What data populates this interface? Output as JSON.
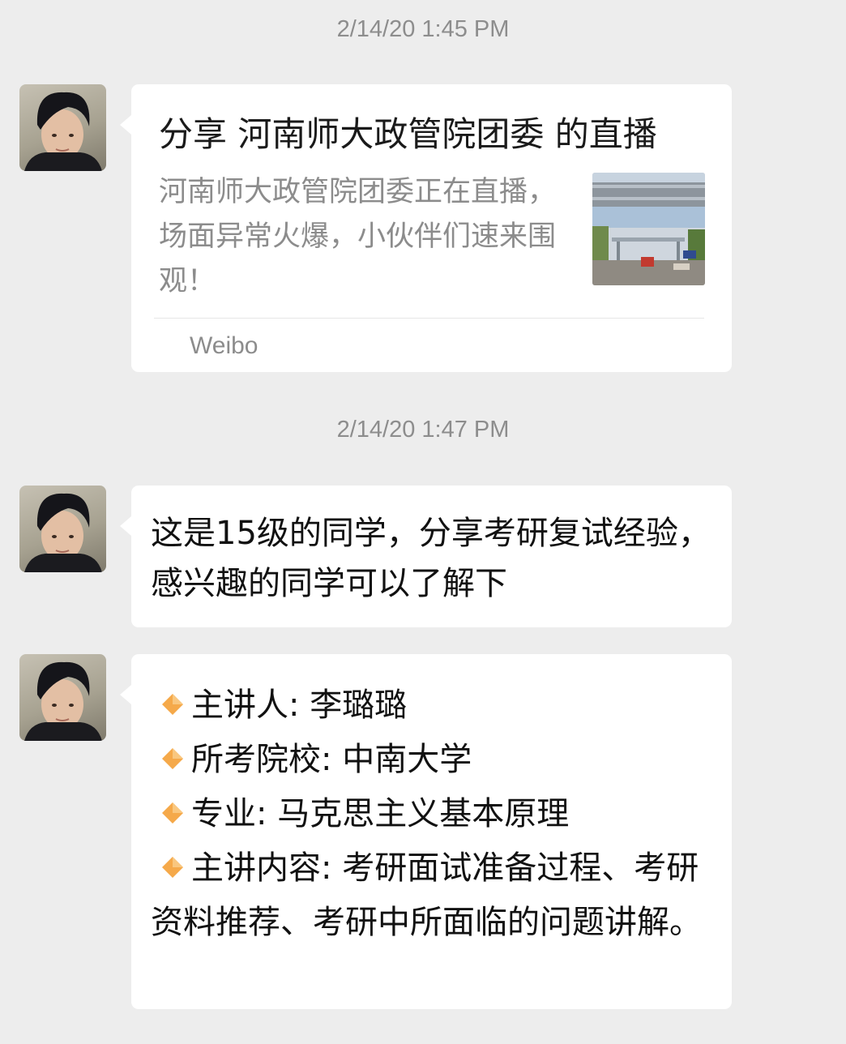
{
  "messages": [
    {
      "timestamp": "2/14/20 1:45 PM",
      "type": "share-card",
      "card": {
        "title": "分享 河南师大政管院团委 的直播",
        "description": "河南师大政管院团委正在直播，场面异常火爆，小伙伴们速来围观！",
        "source": "Weibo"
      }
    },
    {
      "timestamp": "2/14/20 1:47 PM",
      "type": "text",
      "text": "这是15级的同学，分享考研复试经验，感兴趣的同学可以了解下"
    },
    {
      "type": "bullet-text",
      "bullets": [
        "主讲人: 李璐璐",
        "所考院校: 中南大学",
        "专业: 马克思主义基本原理",
        "主讲内容: 考研面试准备过程、考研资料推荐、考研中所面临的问题讲解。"
      ]
    }
  ],
  "icons": {
    "bullet": "orange-diamond-icon",
    "avatar": "user-avatar",
    "thumbnail": "campus-gate-thumbnail"
  },
  "colors": {
    "background": "#ededed",
    "bubble": "#ffffff",
    "timestamp": "#8d8d8d",
    "muted_text": "#8c8c8c",
    "bullet_orange": "#f5a94a"
  }
}
